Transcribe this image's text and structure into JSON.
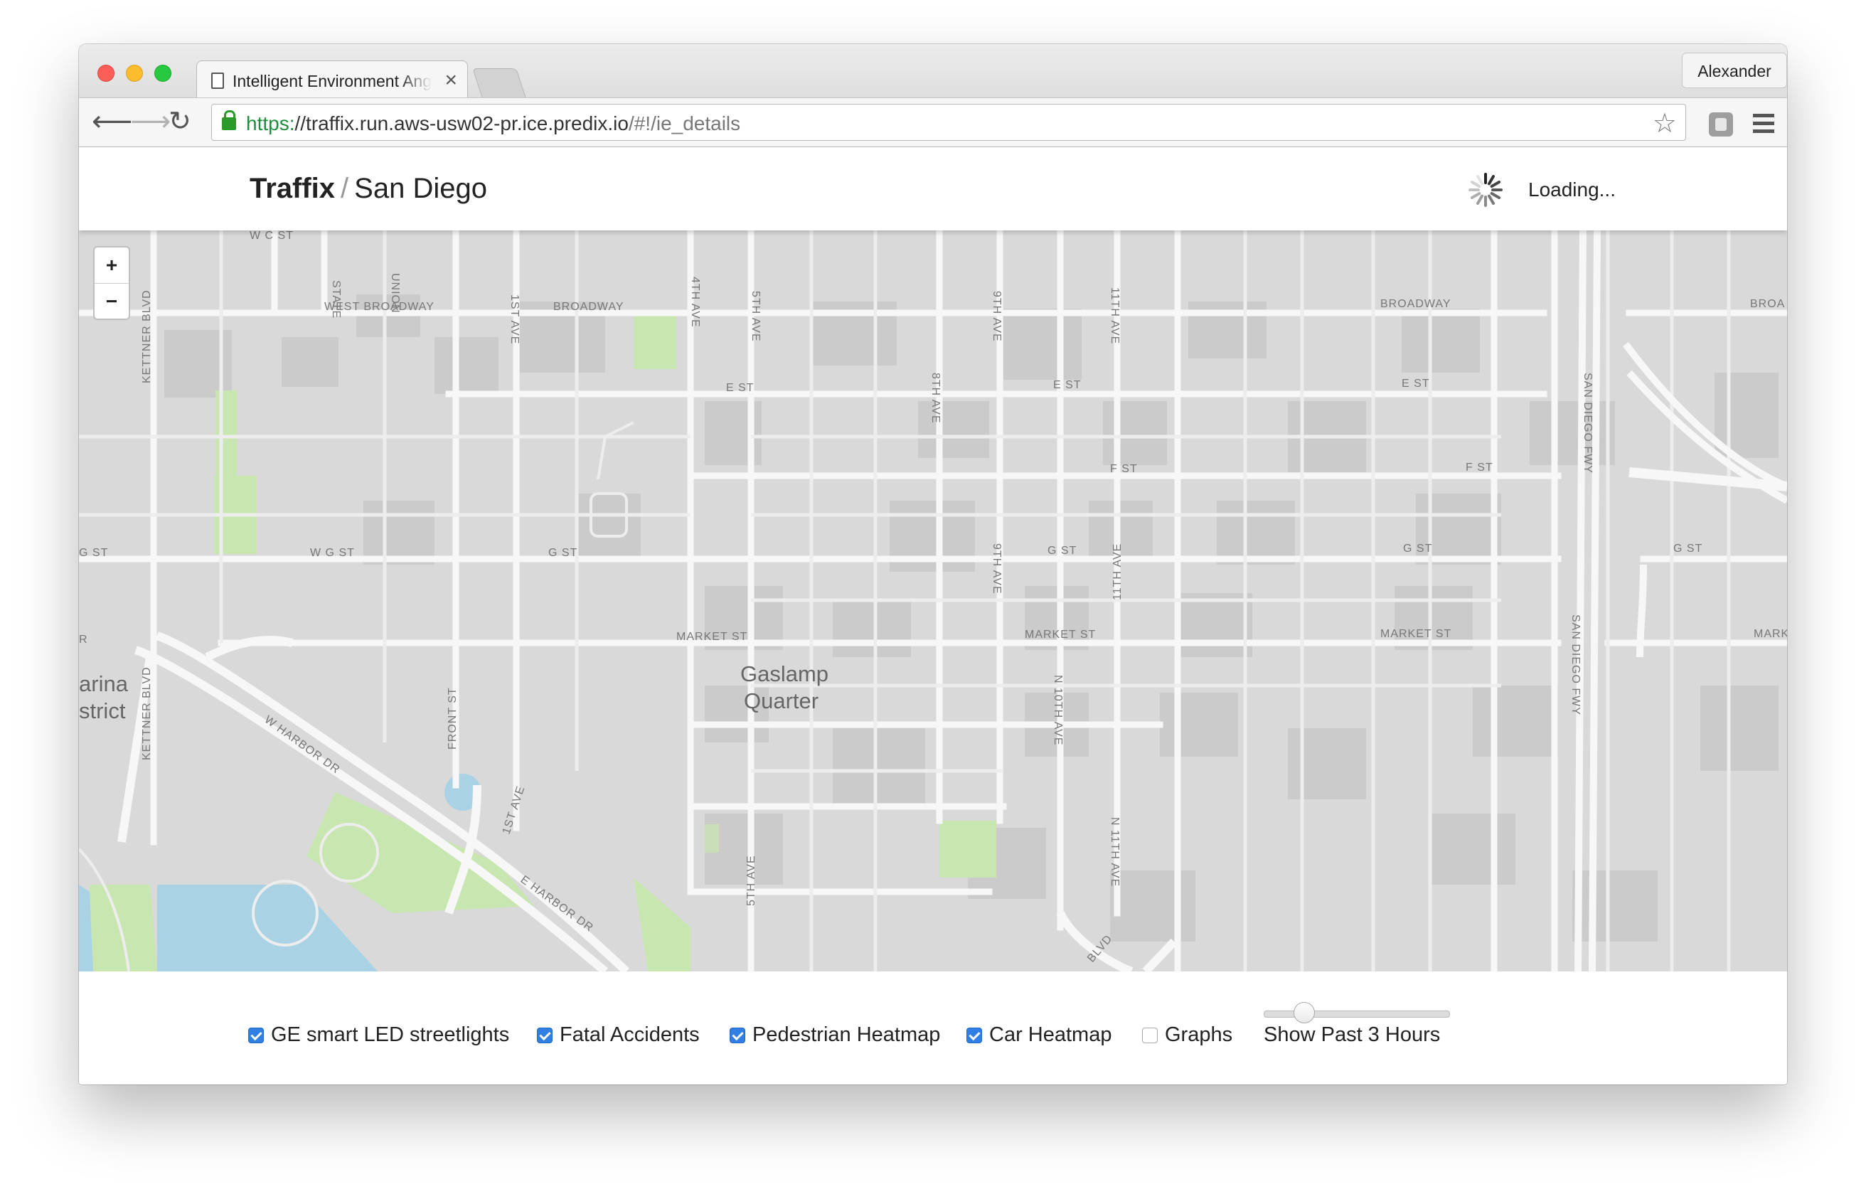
{
  "browser": {
    "tab_title": "Intelligent Environment Ang",
    "profile_name": "Alexander",
    "url_scheme": "https:",
    "url_host": "//traffix.run.aws-usw02-pr.ice.predix.io",
    "url_path": "/#!/ie_details"
  },
  "header": {
    "brand": "Traffix",
    "separator": "/",
    "city": "San Diego",
    "status_text": "Loading..."
  },
  "map": {
    "zoom_in_label": "+",
    "zoom_out_label": "−",
    "district_line1": "Gaslamp",
    "district_line2": "Quarter",
    "marina_line1": "arina",
    "marina_line2": "strict",
    "street_labels": {
      "w_c_st": "W C ST",
      "state": "STATE",
      "union": "UNION",
      "west_broadway": "WEST BROADWAY",
      "broadway": "BROADWAY",
      "broadway_east": "BROADWAY",
      "broa": "BROA",
      "kettner_north": "KETTNER BLVD",
      "kettner_south": "KETTNER BLVD",
      "first_ave": "1ST AVE",
      "fourth_ave": "4TH AVE",
      "fifth_ave": "5TH AVE",
      "fifth_ave_south": "5TH AVE",
      "eighth_ave": "8TH AVE",
      "ninth_ave": "9TH AVE",
      "ninth_ave_south": "9TH AVE",
      "eleventh_ave": "11TH AVE",
      "eleventh_ave_mid": "11TH AVE",
      "n_tenth_ave": "N 10TH AVE",
      "n_eleventh_ave": "N 11TH AVE",
      "e_st_1": "E ST",
      "e_st_2": "E ST",
      "e_st_3": "E ST",
      "f_st_1": "F ST",
      "f_st_2": "F ST",
      "g_st_west": "G ST",
      "w_g_st": "W G ST",
      "g_st_1": "G ST",
      "g_st_2": "G ST",
      "g_st_3": "G ST",
      "g_st_4": "G ST",
      "market_1": "MARKET ST",
      "market_2": "MARKET ST",
      "market_3": "MARKET ST",
      "mark": "MARK",
      "front_st": "FRONT ST",
      "w_harbor": "W HARBOR DR",
      "e_harbor": "E HARBOR DR",
      "first_ave_diag": "1ST AVE",
      "san_diego_fwy_1": "SAN DIEGO FWY",
      "san_diego_fwy_2": "SAN DIEGO FWY",
      "r_west": "R",
      "blvd": "BLVD"
    }
  },
  "controls": {
    "layers": [
      {
        "label": "GE smart LED streetlights",
        "checked": true
      },
      {
        "label": "Fatal Accidents",
        "checked": true
      },
      {
        "label": "Pedestrian Heatmap",
        "checked": true
      },
      {
        "label": "Car Heatmap",
        "checked": true
      },
      {
        "label": "Graphs",
        "checked": false
      }
    ],
    "time_window_label": "Show Past 3 Hours",
    "time_window_hours": 3
  }
}
